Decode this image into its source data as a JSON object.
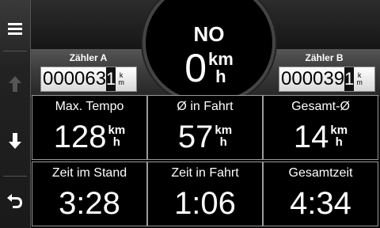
{
  "sidebar": {
    "menu_icon": "hamburger-menu-icon",
    "up_icon": "arrow-up-icon",
    "down_icon": "arrow-down-icon",
    "back_icon": "back-arrow-icon"
  },
  "counter_a": {
    "label": "Zähler A",
    "digits": "000063",
    "fraction": "1",
    "unit_top": "k",
    "unit_bottom": "m"
  },
  "counter_b": {
    "label": "Zähler B",
    "digits": "000039",
    "fraction": "1",
    "unit_top": "k",
    "unit_bottom": "m"
  },
  "heading": {
    "label": "NO"
  },
  "speed": {
    "value": "0",
    "unit_top": "km",
    "unit_bottom": "h"
  },
  "stats": [
    {
      "label": "Max. Tempo",
      "value": "128",
      "unit_top": "km",
      "unit_bottom": "h"
    },
    {
      "label": "Ø in Fahrt",
      "value": "57",
      "unit_top": "km",
      "unit_bottom": "h"
    },
    {
      "label": "Gesamt-Ø",
      "value": "14",
      "unit_top": "km",
      "unit_bottom": "h"
    },
    {
      "label": "Zeit im Stand",
      "value": "3:28",
      "unit_top": "",
      "unit_bottom": ""
    },
    {
      "label": "Zeit in Fahrt",
      "value": "1:06",
      "unit_top": "",
      "unit_bottom": ""
    },
    {
      "label": "Gesamtzeit",
      "value": "4:34",
      "unit_top": "",
      "unit_bottom": ""
    }
  ]
}
